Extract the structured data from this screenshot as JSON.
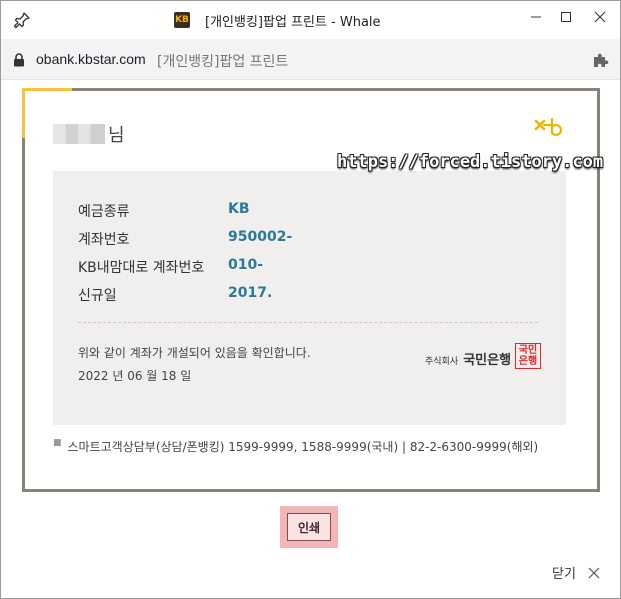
{
  "window": {
    "title": "[개인뱅킹]팝업 프린트 - Whale",
    "favicon_text": "KB",
    "pin_icon": "pin-icon",
    "minimize_icon": "minimize-icon",
    "maximize_icon": "maximize-icon",
    "close_icon": "close-icon"
  },
  "address": {
    "url": "obank.kbstar.com",
    "page_title": "[개인뱅킹]팝업 프린트",
    "lock_icon": "lock-icon",
    "extension_icon": "puzzle-icon"
  },
  "document": {
    "name_suffix": "님",
    "watermark": "https://forced.tistory.com",
    "rows": [
      {
        "label": "예금종류",
        "value": "KB"
      },
      {
        "label": "계좌번호",
        "value": "950002-"
      },
      {
        "label": "KB내맘대로 계좌번호",
        "value": "010-"
      },
      {
        "label": "신규일",
        "value": "2017."
      }
    ],
    "confirm_text": "위와 같이 계좌가 개설되어 있음을 확인합니다.",
    "date_text": "2022 년 06 월 18 일",
    "bank_prefix": "주식회사",
    "bank_name": "국민은행",
    "seal_text": "국민 은행",
    "contact_text": "스마트고객상담부(상담/폰뱅킹) 1599-9999, 1588-9999(국내) | 82-2-6300-9999(해외)"
  },
  "actions": {
    "print_label": "인쇄",
    "close_label": "닫기"
  },
  "colors": {
    "accent_yellow": "#f5c242",
    "value_blue": "#2a7a9a",
    "seal_red": "#d2302c",
    "print_highlight": "#f4b5b8"
  }
}
